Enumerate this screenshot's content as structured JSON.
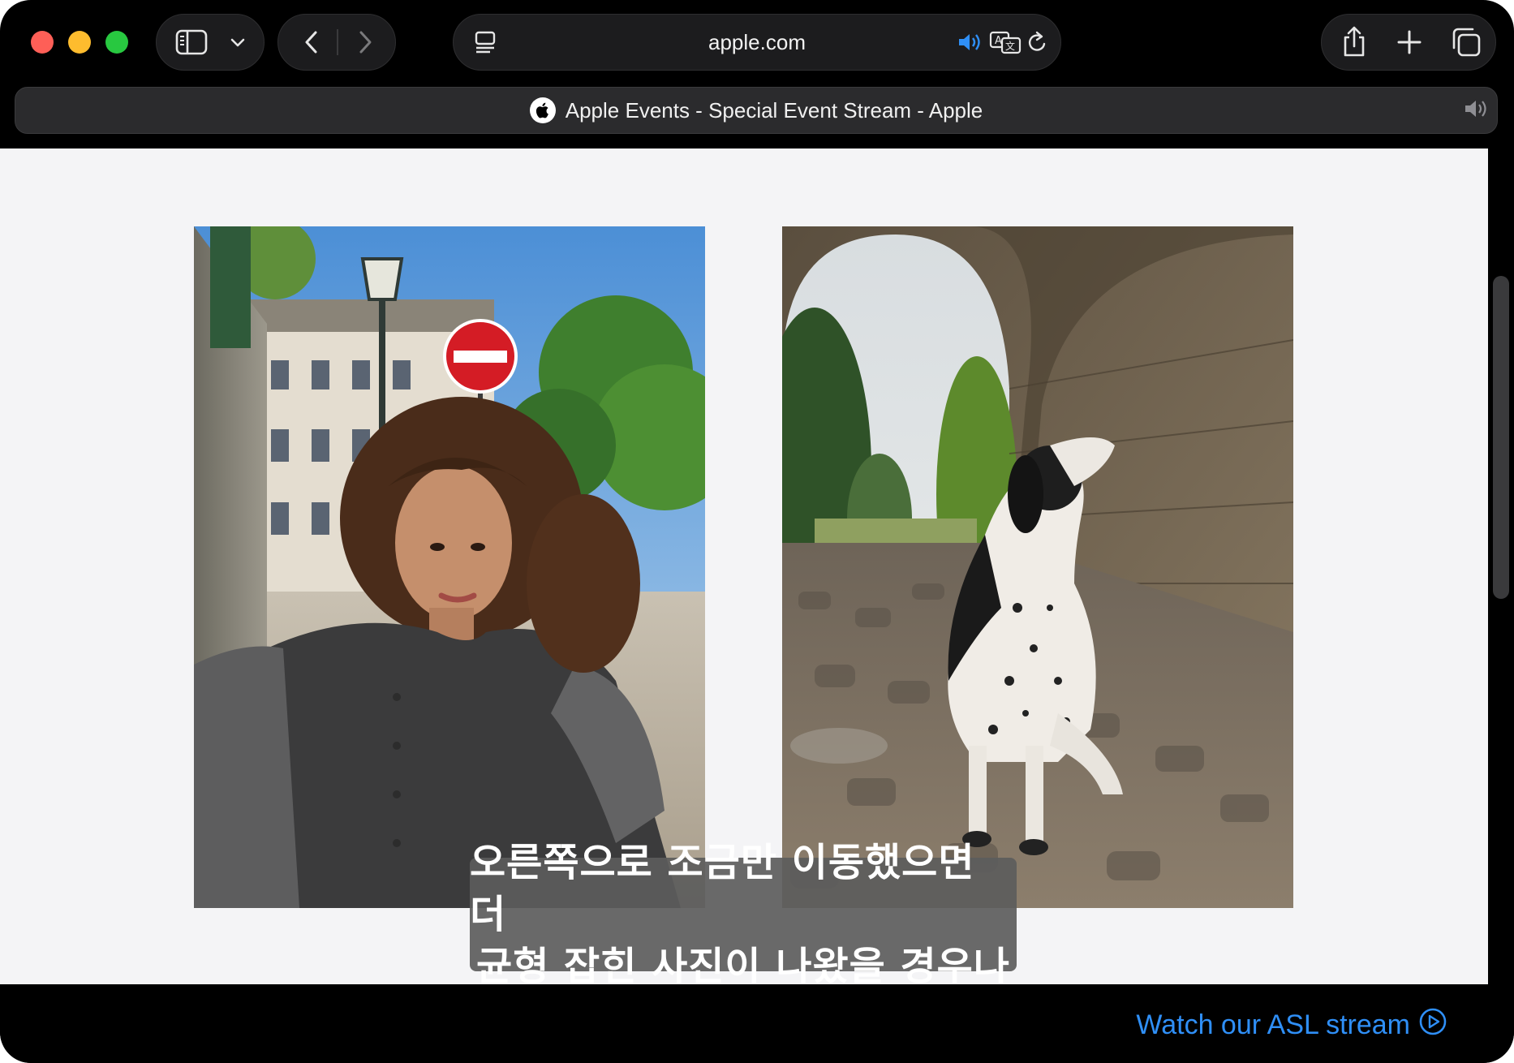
{
  "toolbar": {
    "address": "apple.com",
    "icons": [
      "sidebar-icon",
      "chevron-down-icon",
      "back-icon",
      "forward-icon",
      "reader-icon",
      "speaker-icon",
      "translate-icon",
      "reload-icon",
      "share-icon",
      "plus-icon",
      "tabs-overview-icon"
    ]
  },
  "tab": {
    "title": "Apple Events - Special Event Stream - Apple",
    "favicon": "apple-logo-icon",
    "audio_icon": "speaker-icon"
  },
  "content": {
    "photos": [
      {
        "name": "portrait-woman-photo",
        "subject": "woman-with-curly-hair"
      },
      {
        "name": "dog-under-arch-photo",
        "subject": "dog-under-stone-arch"
      }
    ],
    "captions": {
      "line1": "오른쪽으로 조금만 이동했으면 더",
      "line2": "균형 잡힌 사진이 나왔을 경우나"
    }
  },
  "footer": {
    "asl_link": "Watch our ASL stream",
    "asl_icon": "play-circle-icon"
  },
  "colors": {
    "accent": "#2f8ff7",
    "traffic_red": "#fe5f57",
    "traffic_yellow": "#febc2e",
    "traffic_green": "#28c840",
    "page_background": "#f4f4f6"
  }
}
